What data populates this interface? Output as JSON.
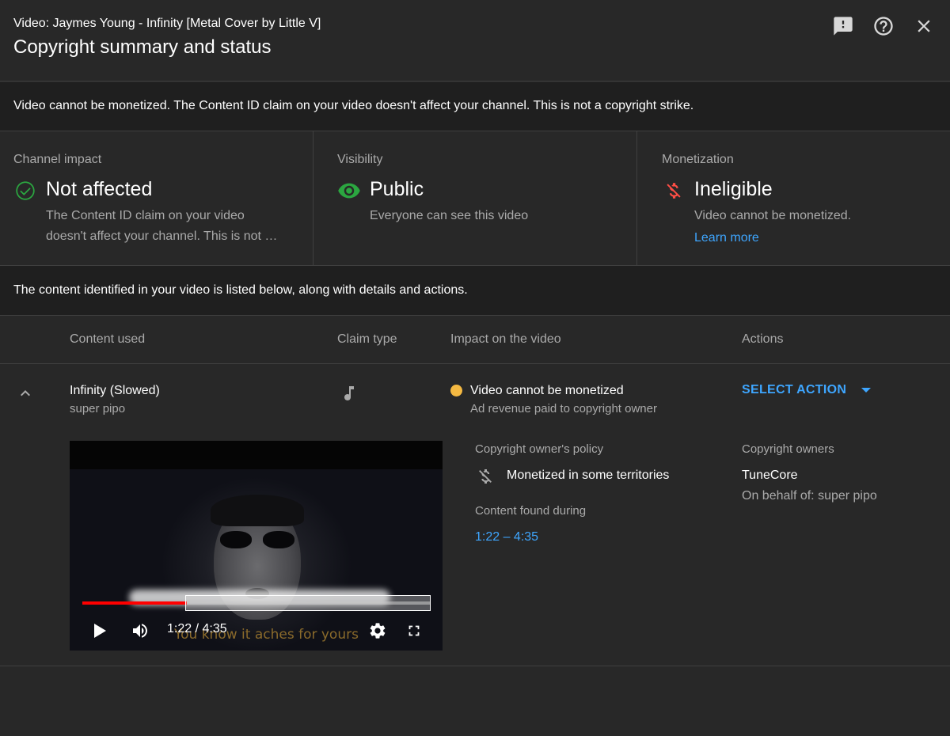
{
  "header": {
    "subtitle": "Video: Jaymes Young - Infinity [Metal Cover by Little V]",
    "title": "Copyright summary and status",
    "icons": [
      "feedback-icon",
      "help-icon",
      "close-icon"
    ]
  },
  "banner": {
    "text": "Video cannot be monetized. The Content ID claim on your video doesn't affect your channel. This is not a copyright strike."
  },
  "cards": {
    "channel_impact": {
      "label": "Channel impact",
      "value": "Not affected",
      "desc_line1": "The Content ID claim on your video",
      "desc_line2": "doesn't affect your channel. This is not …",
      "icon": "check-circle-icon",
      "color": "#2ba640"
    },
    "visibility": {
      "label": "Visibility",
      "value": "Public",
      "desc": "Everyone can see this video",
      "icon": "eye-icon",
      "color": "#2ba640"
    },
    "monetization": {
      "label": "Monetization",
      "value": "Ineligible",
      "desc": "Video cannot be monetized.",
      "link": "Learn more",
      "icon": "money-off-icon",
      "color": "#ff4e45"
    }
  },
  "info": {
    "text": "The content identified in your video is listed below, along with details and actions."
  },
  "table": {
    "headers": {
      "content_used": "Content used",
      "claim_type": "Claim type",
      "impact": "Impact on the video",
      "actions": "Actions"
    },
    "row": {
      "title": "Infinity (Slowed)",
      "artist": "super pipo",
      "claim_type_icon": "music-note-icon",
      "impact_title": "Video cannot be monetized",
      "impact_sub": "Ad revenue paid to copyright owner",
      "impact_color": "#f4b942",
      "action_label": "SELECT ACTION",
      "policy_label": "Copyright owner's policy",
      "policy_value": "Monetized in some territories",
      "found_label": "Content found during",
      "found_value": "1:22 – 4:35",
      "owners_label": "Copyright owners",
      "owner_name": "TuneCore",
      "owner_behalf": "On behalf of: super pipo"
    }
  },
  "player": {
    "time": "1:22 / 4:35",
    "caption": "You know it aches for yours",
    "progress": 0.3
  }
}
